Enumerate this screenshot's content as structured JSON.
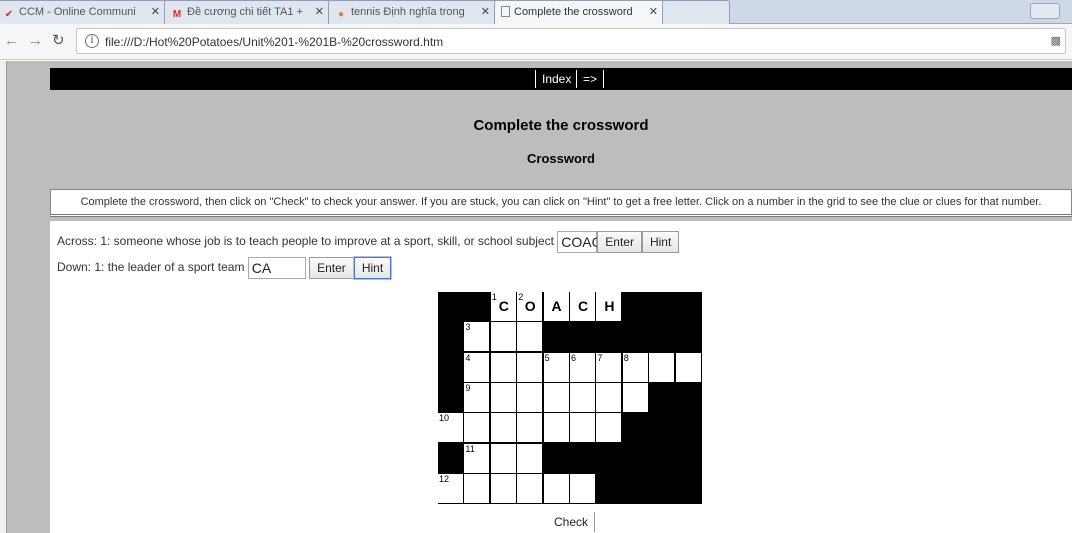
{
  "browser": {
    "tabs": [
      {
        "label": "CCM - Online Communi",
        "icon": "ccm-icon"
      },
      {
        "label": "Đề cương chi tiết TA1 +",
        "icon": "gmail-icon"
      },
      {
        "label": "tennis Định nghĩa trong",
        "icon": "dictionary-icon"
      },
      {
        "label": "Complete the crossword",
        "icon": "page-icon"
      }
    ],
    "url": "file:///D:/Hot%20Potatoes/Unit%201-%201B-%20crossword.htm"
  },
  "nav": {
    "index_label": "Index",
    "next_label": "=>"
  },
  "page": {
    "title": "Complete the crossword",
    "subtitle": "Crossword",
    "instructions": "Complete the crossword, then click on \"Check\" to check your answer. If you are stuck, you can click on \"Hint\" to get a free letter. Click on a number in the grid to see the clue or clues for that number."
  },
  "clues": {
    "across": {
      "text": "Across: 1: someone whose job is to teach people to improve at a sport, skill, or school subject",
      "value": "COAC"
    },
    "down": {
      "text": "Down: 1: the leader of a sport team",
      "value": "CA"
    },
    "enter_label": "Enter",
    "hint_label": "Hint"
  },
  "grid": {
    "rows": [
      [
        "#",
        "#",
        "1C",
        "2O",
        "A",
        "C",
        "H",
        "#",
        "#",
        "#"
      ],
      [
        "#",
        "3",
        "",
        "",
        "#",
        "#",
        "#",
        "#",
        "#",
        "#"
      ],
      [
        "#",
        "4",
        "",
        "",
        "5",
        "6",
        "7",
        "8",
        "",
        ""
      ],
      [
        "#",
        "9",
        "",
        "",
        "",
        "",
        "",
        "",
        "#",
        "#"
      ],
      [
        "10",
        "",
        "",
        "",
        "",
        "",
        "",
        "#",
        "#",
        "#"
      ],
      [
        "#",
        "11",
        "",
        "",
        "#",
        "#",
        "#",
        "#",
        "#",
        "#"
      ],
      [
        "12",
        "",
        "",
        "",
        "",
        "",
        "#",
        "#",
        "#",
        "#"
      ]
    ]
  },
  "check_label": "Check"
}
